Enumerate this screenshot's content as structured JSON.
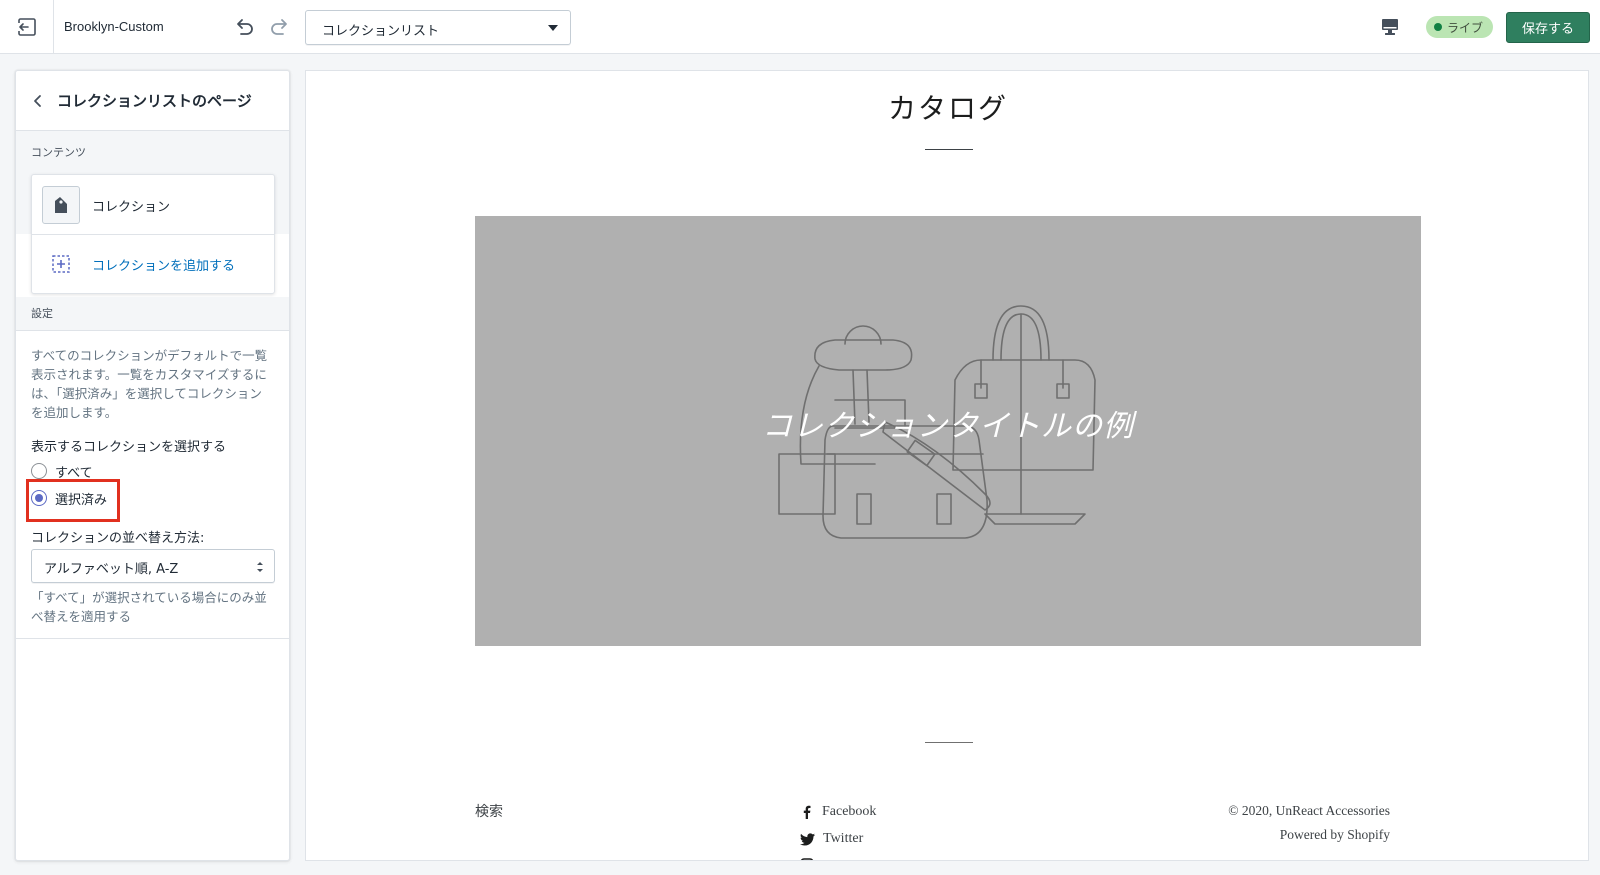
{
  "topbar": {
    "theme_name": "Brooklyn-Custom",
    "page_select_value": "コレクションリスト",
    "live_label": "ライブ",
    "save_label": "保存する"
  },
  "sidebar": {
    "title": "コレクションリストのページ",
    "content_section_label": "コンテンツ",
    "collection_name": "コレクション",
    "add_collection_label": "コレクションを追加する",
    "settings_section_label": "設定",
    "help_text": "すべてのコレクションがデフォルトで一覧表示されます。一覧をカスタマイズするには、「選択済み」を選択してコレクションを追加します。",
    "select_label": "表示するコレクションを選択する",
    "radio_all": "すべて",
    "radio_selected": "選択済み",
    "selected_option": "選択済み",
    "sort_label": "コレクションの並べ替え方法:",
    "sort_value": "アルファベット順, A-Z",
    "sort_hint": "「すべて」が選択されている場合にのみ並べ替えを適用する"
  },
  "preview": {
    "page_title": "カタログ",
    "collection_caption": "コレクションタイトルの例",
    "footer_search": "検索",
    "social": [
      "Facebook",
      "Twitter"
    ],
    "copyright": "© 2020, UnReact Accessories",
    "powered_by": "Powered by Shopify"
  },
  "colors": {
    "save_button": "#2f7f5f",
    "live_badge": "#bbe5b3",
    "link": "#006fbb",
    "highlight": "#e1301f",
    "image_placeholder": "#b0b0b0"
  }
}
